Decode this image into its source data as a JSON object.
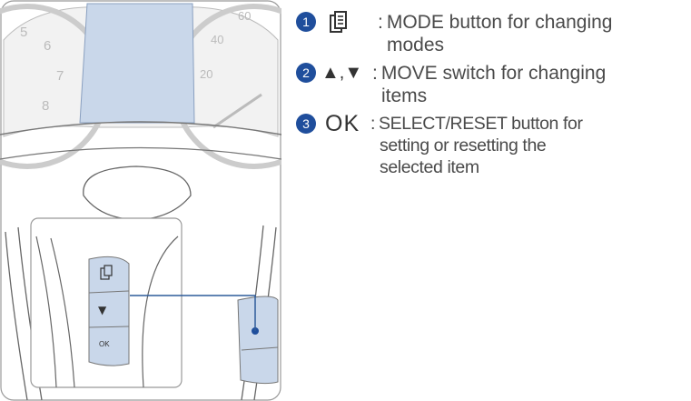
{
  "legend": {
    "items": [
      {
        "number": "1",
        "symbol": "mode-icon",
        "colon": ":",
        "line1": "MODE button for changing",
        "line2": "modes"
      },
      {
        "number": "2",
        "symbol": "▲,▼",
        "colon": ":",
        "line1": "MOVE switch for changing",
        "line2": "items"
      },
      {
        "number": "3",
        "symbol": "OK",
        "colon": ":",
        "line1": "SELECT/RESET button for",
        "line2": "setting or resetting the",
        "line3": "selected item"
      }
    ]
  },
  "illustration": {
    "speedo_numbers": [
      "60",
      "40",
      "20"
    ],
    "tacho_numbers": [
      "5",
      "6",
      "7",
      "8"
    ],
    "switch_labels": {
      "down": "▼",
      "ok": "OK"
    }
  },
  "colors": {
    "accent": "#1f4e9c",
    "display": "#c9d7ea",
    "line": "#2d5b9a"
  }
}
